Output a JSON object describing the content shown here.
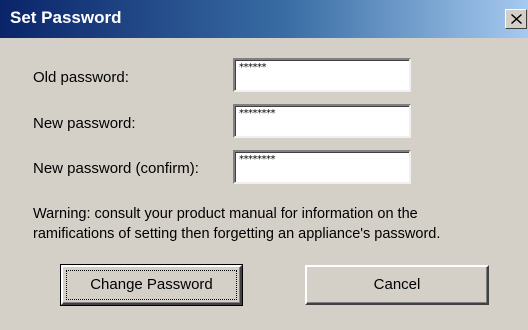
{
  "window": {
    "title": "Set Password",
    "close_glyph": "✕",
    "close_icon": "close-icon"
  },
  "form": {
    "old_password": {
      "label": "Old password:",
      "value": "******"
    },
    "new_password": {
      "label": "New password:",
      "value": "********"
    },
    "confirm_password": {
      "label": "New password (confirm):",
      "value": "********"
    }
  },
  "warning": {
    "line1": "Warning: consult your product manual for information on the",
    "line2": "ramifications of setting then forgetting an appliance's password."
  },
  "buttons": {
    "change_password": "Change Password",
    "cancel": "Cancel"
  },
  "colors": {
    "titlebar_start": "#0a246a",
    "titlebar_end": "#a6caf0",
    "dialog_face": "#d4d0c8"
  }
}
